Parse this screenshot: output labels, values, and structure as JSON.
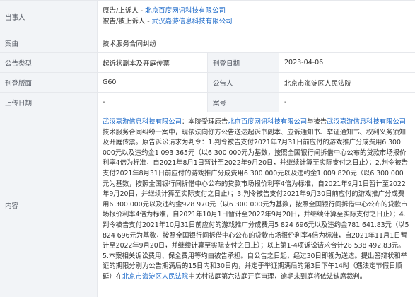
{
  "parties": {
    "label": "当事人",
    "line1_prefix": "原告/上诉人 - ",
    "line1_name": "北京百度网讯科技有限公司",
    "line2_prefix": "被告/被上诉人 - ",
    "line2_name": "武汉嘉游信息科技有限公司"
  },
  "case": {
    "label": "案由",
    "value": "技术服务合同纠纷"
  },
  "notice_type": {
    "label": "公告类型",
    "value": "起诉状副本及开庭传票"
  },
  "publish_date": {
    "label": "刊登日期",
    "value": "2023-04-06"
  },
  "page": {
    "label": "刊登版面",
    "value": "G60"
  },
  "announcer": {
    "label": "公告人",
    "value": "北京市海淀区人民法院"
  },
  "upload_date": {
    "label": "上传日期",
    "value": "-"
  },
  "case_number": {
    "label": "案号",
    "value": "-"
  },
  "content": {
    "label": "内容",
    "seg1_link": "武汉嘉游信息科技有限公司",
    "seg2": "：本院受理原告",
    "seg3_link": "北京百度网讯科技有限公司",
    "seg4": "与被告",
    "seg5_link": "武汉嘉游信息科技有限公司",
    "seg6": "技术服务合同纠纷一案中，现依法向你方公告送达起诉书副本、应诉通知书、举证通知书、权利义务须知及开庭传票。原告诉讼请求为判令：1.判令被告支付2021年7月31日前应付的游戏推广分成费用6 300 000元以及违约金1 093 365元（以6 300 000元为基数，按照全国银行间拆借中心公布的贷款市场报价利率4倍为标准，自2021年8月1日暂计至2022年9月20日，并继续计算至实际支付之日止）；2.判令被告支付2021年8月31日前应付的游戏推广分成费用6 300 000元以及违约金1 009 820元（以6 300 000元为基数，按照全国银行间拆借中心公布的贷款市场报价利率4倍为标准，自2021年9月1日暂计至2022年9月20日，并继续计算至实际支付之日止）；3.判令被告支付2021年9月30日前应付的游戏推广分成费用6 300 000元以及违约金928 970元（以6 300 000元为基数，按照全国银行间拆借中心公布的贷款市场报价利率4倍为标准，自2021年10月1日暂计至2022年9月20日，并继续计算至实际支付之日止）；4.判令被告支付2021年10月31日前应付的游戏推广分成费用5 824 696元以及违约金781 641.83元（以5 824 696元为基数，按照全国银行间拆借中心公布的贷款市场报价利率4倍为标准，自2021年11月1日暂计至2022年9月20日，并继续计算至实际支付之日止）；以上第1-4项诉讼请求合计28 538 492.83元。5.本案相关诉讼费用、保全费用等均由被告承担。自公告之日起，经过30日即视为送达。提出答辩状和举证的期限分别为公告期满后的15日内和30日内，并定于举证期满后的第3日下午14时（遇法定节假日顺延）在",
    "seg7_link": "北京市海淀区人民法院",
    "seg8": "中关村法庭第六法庭开庭审理，逾期未到庭将依法缺席裁判。"
  }
}
